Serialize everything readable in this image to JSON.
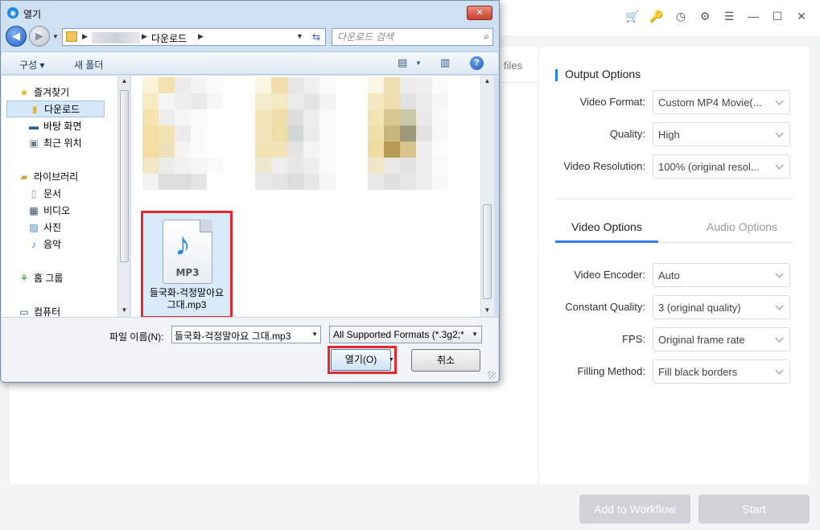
{
  "app": {
    "files_label": "files",
    "output_options": {
      "title": "Output Options",
      "rows": [
        {
          "label": "Video Format:",
          "value": "Custom MP4 Movie(..."
        },
        {
          "label": "Quality:",
          "value": "High"
        },
        {
          "label": "Video Resolution:",
          "value": "100% (original resol..."
        }
      ]
    },
    "tabs": {
      "video": "Video Options",
      "audio": "Audio Options"
    },
    "video_options": [
      {
        "label": "Video Encoder:",
        "value": "Auto"
      },
      {
        "label": "Constant Quality:",
        "value": "3 (original quality)"
      },
      {
        "label": "FPS:",
        "value": "Original frame rate"
      },
      {
        "label": "Filling Method:",
        "value": "Fill black borders"
      }
    ],
    "buttons": {
      "add_to_workflow": "Add to Workflow",
      "start": "Start"
    },
    "top_icons": [
      "cart-icon",
      "key-icon",
      "clock-icon",
      "gear-icon",
      "menu-icon",
      "minimize-icon",
      "maximize-icon",
      "close-icon"
    ]
  },
  "dialog": {
    "title": "열기",
    "close_glyph": "✕",
    "address": {
      "crumb": "다운로드"
    },
    "search_placeholder": "다운로드 검색",
    "toolbar": {
      "organize": "구성 ▾",
      "new_folder": "새 폴더"
    },
    "nav": {
      "favorites": "즐겨찾기",
      "downloads": "다운로드",
      "desktop": "바탕 화면",
      "recent": "최근 위치",
      "libraries": "라이브러리",
      "documents": "문서",
      "videos": "비디오",
      "pictures": "사진",
      "music": "음악",
      "homegroup": "홈 그룹",
      "computer": "컴퓨터"
    },
    "file": {
      "type_label": "MP3",
      "name": "들국화-걱정말아요 그대.mp3"
    },
    "filename_label": "파일 이름(N):",
    "filename_value": "들국화-걱정말아요 그대.mp3",
    "filetype_value": "All Supported Formats (*.3g2;*",
    "open_button": "열기(O)",
    "cancel_button": "취소"
  }
}
